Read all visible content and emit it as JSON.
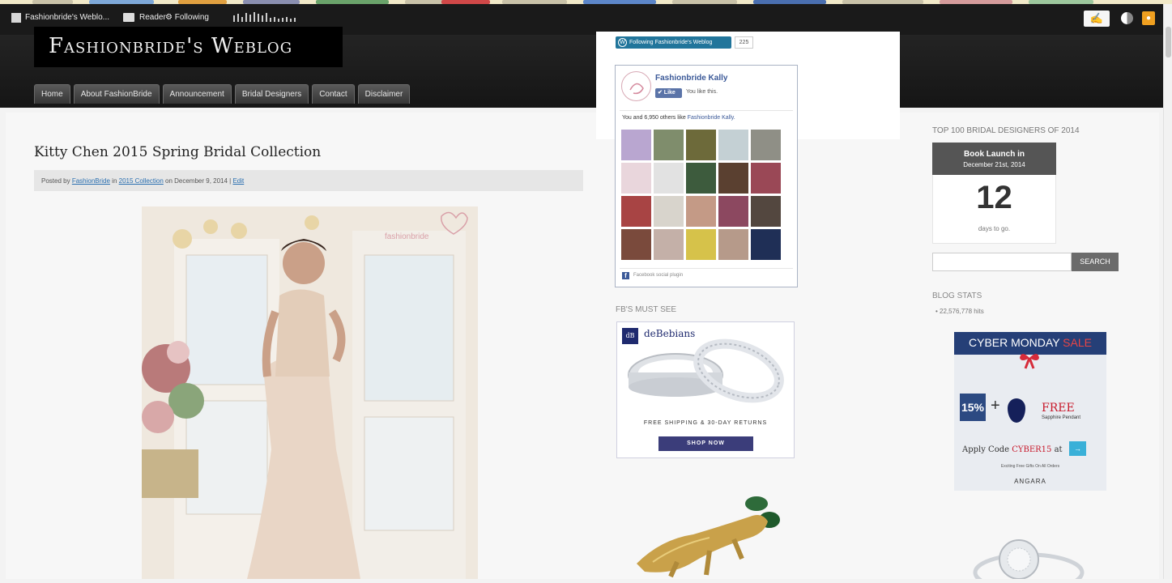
{
  "wp_toolbar": {
    "site_name": "Fashionbride's Weblo...",
    "reader_label": "Reader",
    "following_label": "⚙ Following",
    "write_label": "✍",
    "notifications_label": "●"
  },
  "site": {
    "title": "Fashionbride's Weblog"
  },
  "nav": {
    "items": [
      {
        "label": "Home"
      },
      {
        "label": "About FashionBride"
      },
      {
        "label": "Announcement"
      },
      {
        "label": "Bridal Designers"
      },
      {
        "label": "Contact"
      },
      {
        "label": "Disclaimer"
      }
    ]
  },
  "post": {
    "title": "Kitty Chen 2015 Spring Bridal Collection",
    "meta_prefix": "Posted by ",
    "author": "FashionBride",
    "meta_in": " in ",
    "category": "2015 Collection",
    "meta_on": " on December 9, 2014 | ",
    "edit": "Edit"
  },
  "follow_widget": {
    "button_label": "Following Fashionbride's Weblog",
    "button_icon": "W",
    "count": "225"
  },
  "facebook": {
    "page_name": "Fashionbride Kally",
    "like_label": "✔ Like",
    "you_like": "You like this.",
    "others_prefix": "You and 6,950 others like ",
    "others_page": "Fashionbride Kally.",
    "social_plugin": "Facebook social plugin",
    "icon_label": "f"
  },
  "fbs_must_see": {
    "heading": "FB'S MUST SEE",
    "brand": "deBebians",
    "logo_mark": "dB",
    "shipping": "FREE SHIPPING & 30-DAY RETURNS",
    "shop_now": "SHOP NOW"
  },
  "sidebar": {
    "top100_heading": "TOP 100 BRIDAL DESIGNERS OF 2014",
    "countdown_title": "Book Launch in",
    "countdown_date": "December 21st, 2014",
    "countdown_number": "12",
    "countdown_unit": "days to go.",
    "search_button": "SEARCH",
    "search_value": "",
    "blog_stats_heading": "BLOG STATS",
    "hits": "•  22,576,778 hits"
  },
  "cyber_ad": {
    "title_main": "CYBER MONDAY ",
    "title_sale": "SALE",
    "discount": "15%",
    "plus": "+",
    "free": "FREE",
    "pendant": "Sapphire Pendant",
    "code_prefix": "Apply Code ",
    "code": "CYBER15",
    "code_suffix": " at",
    "cart_icon": "→",
    "fine_print": "Exciting Free Gifts On All Orders",
    "brand": "ANGARA"
  },
  "colors": {
    "wp_bar": "#1a1a1a",
    "follow_blue": "#21759b",
    "fb_blue": "#3b5998",
    "cyber_navy": "#253f77",
    "sale_red": "#e84545"
  }
}
